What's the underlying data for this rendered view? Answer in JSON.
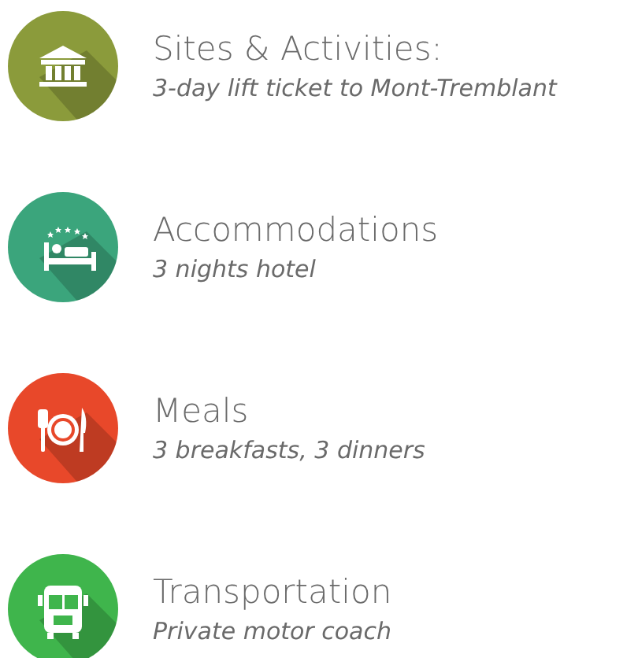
{
  "items": [
    {
      "kind": "museum",
      "color": "#8b9b3b",
      "title": "Sites & Activities:",
      "subtitle": "3-day lift ticket to Mont-Tremblant"
    },
    {
      "kind": "hotel",
      "color": "#3ba57c",
      "title": "Accommodations",
      "subtitle": "3 nights hotel"
    },
    {
      "kind": "meal",
      "color": "#e8482a",
      "title": "Meals",
      "subtitle": "3 breakfasts, 3 dinners"
    },
    {
      "kind": "bus",
      "color": "#3fb54c",
      "title": "Transportation",
      "subtitle": "Private motor coach"
    }
  ]
}
